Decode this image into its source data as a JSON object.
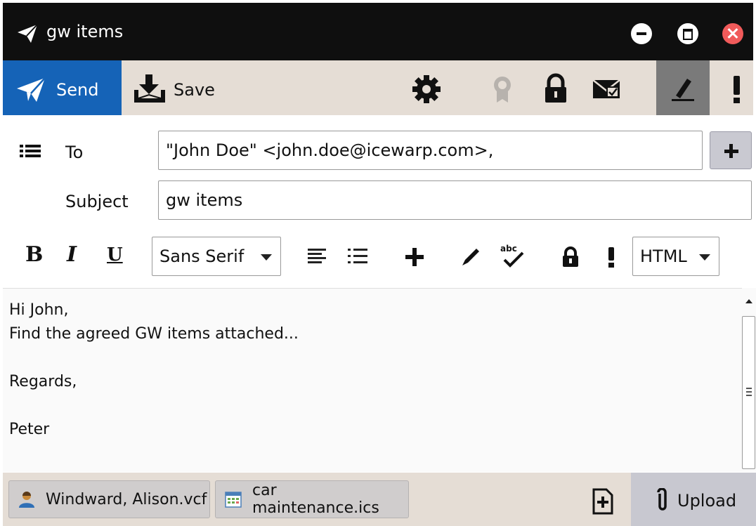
{
  "window": {
    "title": "gw items"
  },
  "toolbar": {
    "send_label": "Send",
    "save_label": "Save",
    "icons": [
      "gear-icon",
      "certificate-icon",
      "lock-icon",
      "read-receipt-icon",
      "signature-pen-icon",
      "priority-icon"
    ]
  },
  "header": {
    "to_label": "To",
    "to_value": "\"John Doe\" <john.doe@icewarp.com>,",
    "subject_label": "Subject",
    "subject_value": "gw items"
  },
  "formatting": {
    "bold": "B",
    "italic": "I",
    "underline": "U",
    "font_family": "Sans Serif",
    "mode": "HTML"
  },
  "body": {
    "lines": [
      "Hi John,",
      "Find the agreed GW items attached...",
      "",
      "Regards,",
      "",
      "Peter"
    ]
  },
  "attachments": [
    {
      "name": "Windward, Alison.vcf",
      "icon": "contact-icon"
    },
    {
      "name": "car maintenance.ics",
      "icon": "calendar-icon"
    }
  ],
  "upload_label": "Upload",
  "colors": {
    "titlebar": "#0f0f0f",
    "send": "#1563b7",
    "toolbar": "#e5ddd5",
    "close": "#f05a5a"
  }
}
